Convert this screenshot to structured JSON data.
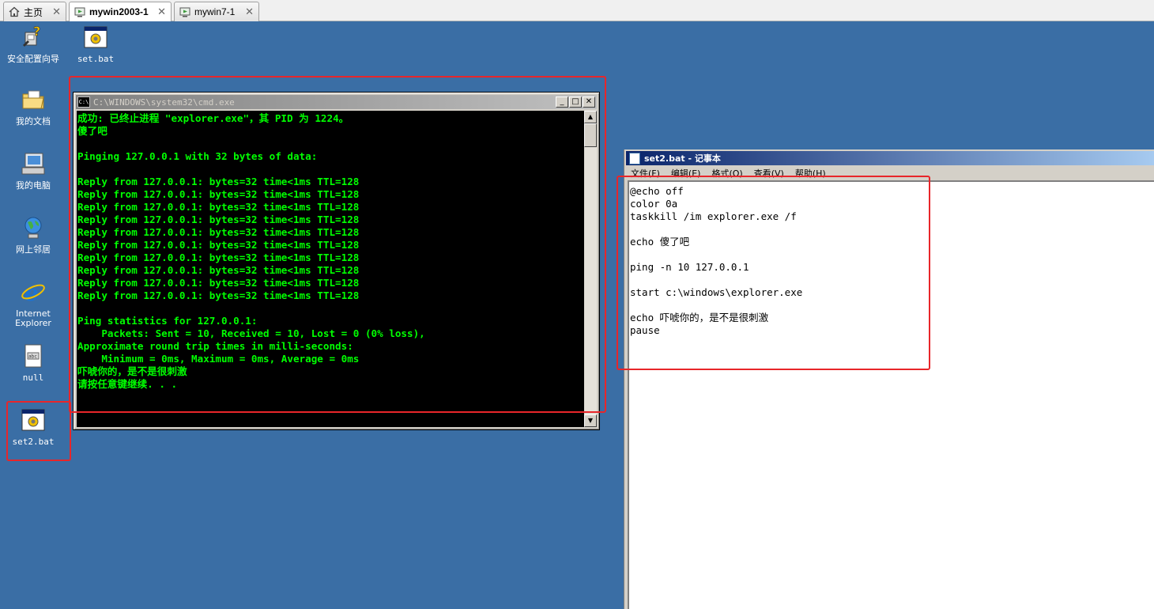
{
  "tabs": [
    {
      "label": "主页",
      "icon": "home-icon"
    },
    {
      "label": "mywin2003-1",
      "icon": "vm-icon"
    },
    {
      "label": "mywin7-1",
      "icon": "vm-icon"
    }
  ],
  "desktop_icons": [
    {
      "label": "安全配置向导",
      "icon": "security-wizard-icon"
    },
    {
      "label": "set.bat",
      "icon": "batch-file-icon"
    },
    {
      "label": "我的文档",
      "icon": "my-documents-icon"
    },
    {
      "label": "我的电脑",
      "icon": "my-computer-icon"
    },
    {
      "label": "网上邻居",
      "icon": "network-places-icon"
    },
    {
      "label": "Internet Explorer",
      "icon": "internet-explorer-icon"
    },
    {
      "label": "null",
      "icon": "file-icon"
    },
    {
      "label": "set2.bat",
      "icon": "batch-file-icon"
    }
  ],
  "cmd": {
    "title": "C:\\WINDOWS\\system32\\cmd.exe",
    "output": "成功: 已终止进程 \"explorer.exe\"，其 PID 为 1224。\n傻了吧\n\nPinging 127.0.0.1 with 32 bytes of data:\n\nReply from 127.0.0.1: bytes=32 time<1ms TTL=128\nReply from 127.0.0.1: bytes=32 time<1ms TTL=128\nReply from 127.0.0.1: bytes=32 time<1ms TTL=128\nReply from 127.0.0.1: bytes=32 time<1ms TTL=128\nReply from 127.0.0.1: bytes=32 time<1ms TTL=128\nReply from 127.0.0.1: bytes=32 time<1ms TTL=128\nReply from 127.0.0.1: bytes=32 time<1ms TTL=128\nReply from 127.0.0.1: bytes=32 time<1ms TTL=128\nReply from 127.0.0.1: bytes=32 time<1ms TTL=128\nReply from 127.0.0.1: bytes=32 time<1ms TTL=128\n\nPing statistics for 127.0.0.1:\n    Packets: Sent = 10, Received = 10, Lost = 0 (0% loss),\nApproximate round trip times in milli-seconds:\n    Minimum = 0ms, Maximum = 0ms, Average = 0ms\n吓唬你的，是不是很刺激\n请按任意键继续. . .",
    "text_color": "#00ff00"
  },
  "notepad": {
    "title": "set2.bat - 记事本",
    "menu": [
      "文件(F)",
      "编辑(E)",
      "格式(O)",
      "查看(V)",
      "帮助(H)"
    ],
    "content": "@echo off\ncolor 0a\ntaskkill /im explorer.exe /f\n\necho 傻了吧\n\nping -n 10 127.0.0.1\n\nstart c:\\windows\\explorer.exe\n\necho 吓唬你的，是不是很刺激\npause"
  },
  "colors": {
    "desktop": "#3a6ea5",
    "annotation": "#e8262a"
  }
}
